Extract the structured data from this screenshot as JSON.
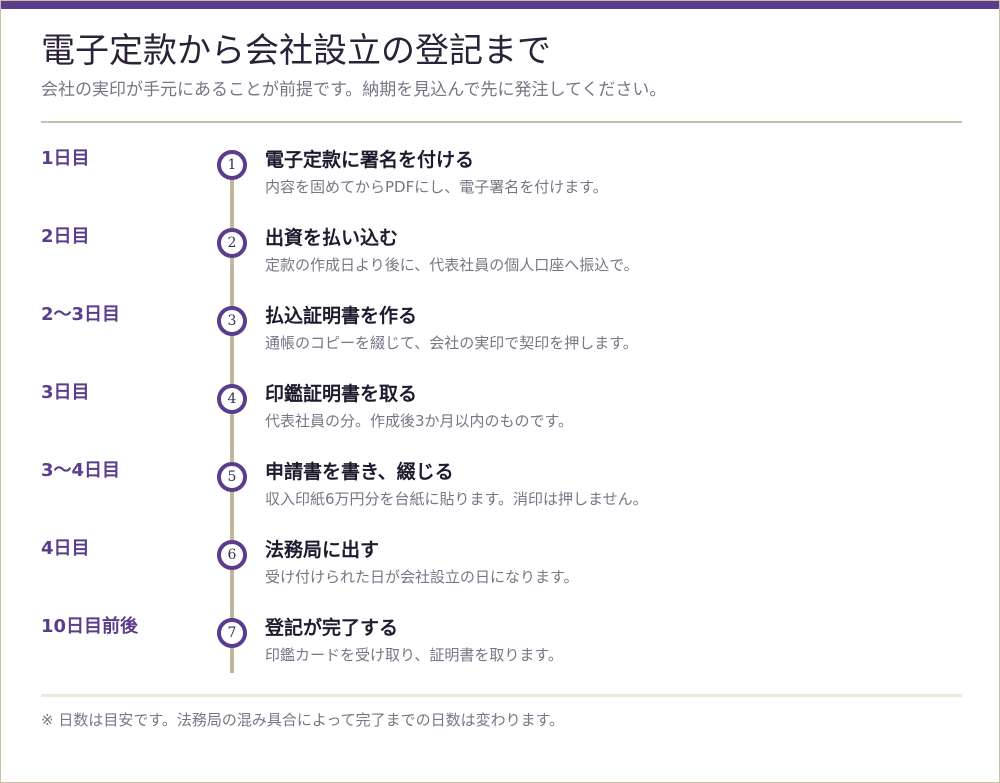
{
  "header": {
    "title": "電子定款から会社設立の登記まで",
    "subtitle": "会社の実印が手元にあることが前提です。納期を見込んで先に発注してください。"
  },
  "steps": [
    {
      "day": "1日目",
      "number": "1",
      "title": "電子定款に署名を付ける",
      "desc": "内容を固めてからPDFにし、電子署名を付けます。"
    },
    {
      "day": "2日目",
      "number": "2",
      "title": "出資を払い込む",
      "desc": "定款の作成日より後に、代表社員の個人口座へ振込で。"
    },
    {
      "day": "2〜3日目",
      "number": "3",
      "title": "払込証明書を作る",
      "desc": "通帳のコピーを綴じて、会社の実印で契印を押します。"
    },
    {
      "day": "3日目",
      "number": "4",
      "title": "印鑑証明書を取る",
      "desc": "代表社員の分。作成後3か月以内のものです。"
    },
    {
      "day": "3〜4日目",
      "number": "5",
      "title": "申請書を書き、綴じる",
      "desc": "収入印紙6万円分を台紙に貼ります。消印は押しません。"
    },
    {
      "day": "4日目",
      "number": "6",
      "title": "法務局に出す",
      "desc": "受け付けられた日が会社設立の日になります。"
    },
    {
      "day": "10日目前後",
      "number": "7",
      "title": "登記が完了する",
      "desc": "印鑑カードを受け取り、証明書を取ります。"
    }
  ],
  "footer": {
    "note": "※ 日数は目安です。法務局の混み具合によって完了までの日数は変わります。"
  },
  "colors": {
    "accent": "#5a3d8c",
    "timeline": "#bfb89b",
    "rule": "#c7c0a6"
  }
}
